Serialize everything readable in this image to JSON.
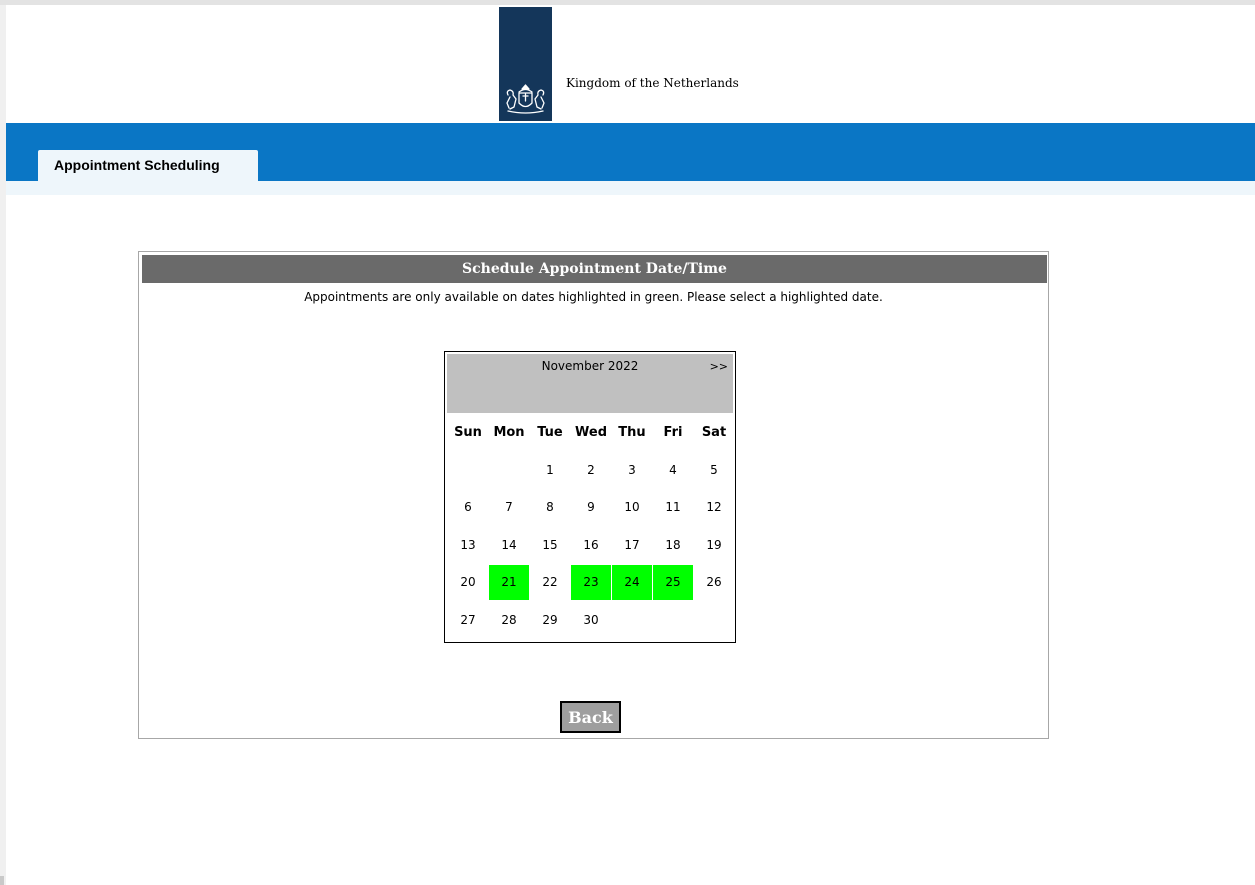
{
  "header": {
    "site_name": "Kingdom of the Netherlands",
    "brand_color": "#14365a",
    "logo_icon": "royal-coat-of-arms-icon"
  },
  "nav": {
    "color": "#0a76c5",
    "tabs": [
      {
        "label": "Appointment Scheduling",
        "active": true
      }
    ]
  },
  "panel": {
    "title": "Schedule Appointment Date/Time",
    "note": "Appointments are only available on dates highlighted in green. Please select a highlighted date."
  },
  "calendar": {
    "month_label": "November 2022",
    "next_label": ">>",
    "available_color": "#00ff00",
    "weekdays": [
      "Sun",
      "Mon",
      "Tue",
      "Wed",
      "Thu",
      "Fri",
      "Sat"
    ],
    "weeks": [
      [
        "",
        "",
        "1",
        "2",
        "3",
        "4",
        "5"
      ],
      [
        "6",
        "7",
        "8",
        "9",
        "10",
        "11",
        "12"
      ],
      [
        "13",
        "14",
        "15",
        "16",
        "17",
        "18",
        "19"
      ],
      [
        "20",
        "21",
        "22",
        "23",
        "24",
        "25",
        "26"
      ],
      [
        "27",
        "28",
        "29",
        "30",
        "",
        "",
        ""
      ]
    ],
    "available_days": [
      "21",
      "23",
      "24",
      "25"
    ]
  },
  "actions": {
    "back_label": "Back"
  }
}
